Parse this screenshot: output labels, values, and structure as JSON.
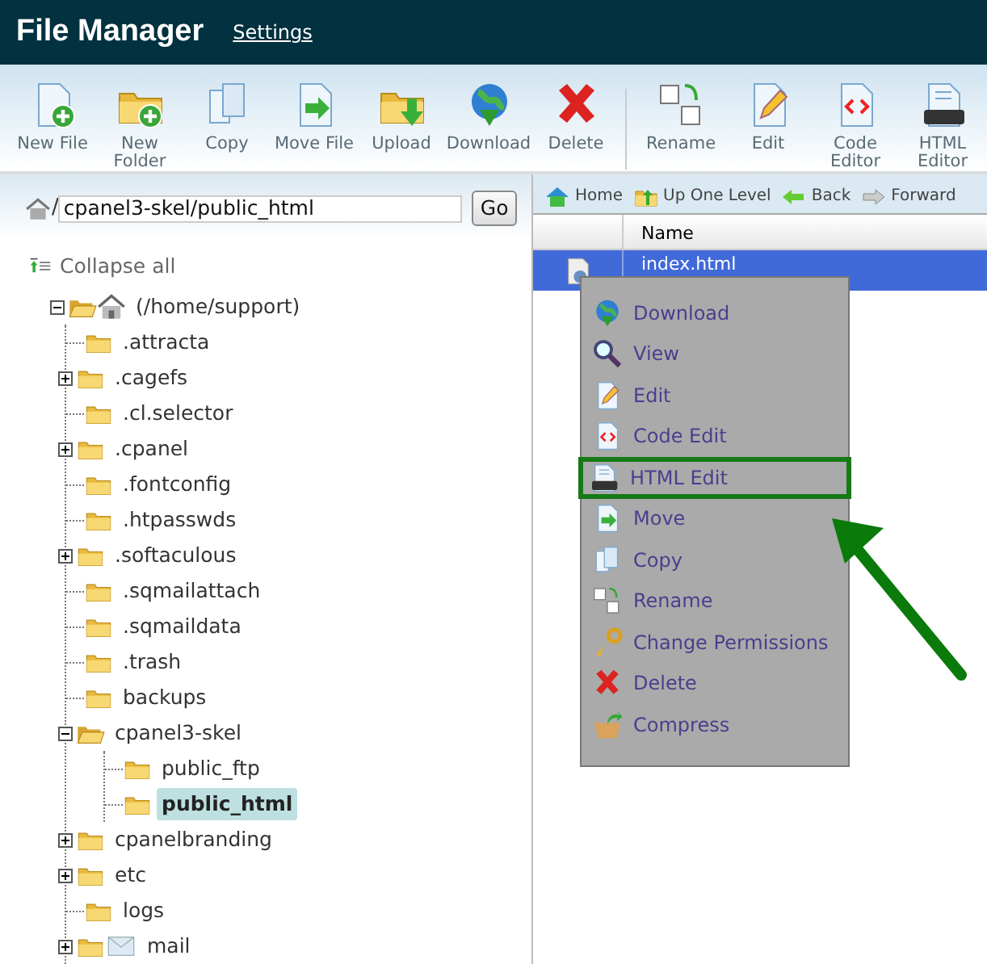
{
  "header": {
    "title": "File Manager",
    "link": "Settings"
  },
  "toolbar_groups": [
    {
      "buttons": [
        "New File",
        "New Folder",
        "Copy",
        "Move File",
        "Upload",
        "Download",
        "Delete"
      ]
    },
    {
      "buttons": [
        "Rename",
        "Edit",
        "Code Editor",
        "HTML Editor"
      ]
    }
  ],
  "path_bar": {
    "separator": "/",
    "value": "cpanel3-skel/public_html",
    "button": "Go"
  },
  "collapse_all": "Collapse all",
  "tree": [
    {
      "label": "(/home/support)",
      "kind": "expanded",
      "home": true,
      "selected": false,
      "children": [
        {
          "label": ".attracta",
          "kind": "leaf",
          "selected": false
        },
        {
          "label": ".cagefs",
          "kind": "collapsed",
          "selected": false
        },
        {
          "label": ".cl.selector",
          "kind": "leaf",
          "selected": false
        },
        {
          "label": ".cpanel",
          "kind": "collapsed",
          "selected": false
        },
        {
          "label": ".fontconfig",
          "kind": "leaf",
          "selected": false
        },
        {
          "label": ".htpasswds",
          "kind": "leaf",
          "selected": false
        },
        {
          "label": ".softaculous",
          "kind": "collapsed",
          "selected": false
        },
        {
          "label": ".sqmailattach",
          "kind": "leaf",
          "selected": false
        },
        {
          "label": ".sqmaildata",
          "kind": "leaf",
          "selected": false
        },
        {
          "label": ".trash",
          "kind": "leaf",
          "selected": false
        },
        {
          "label": "backups",
          "kind": "leaf",
          "selected": false
        },
        {
          "label": "cpanel3-skel",
          "kind": "expanded",
          "selected": false,
          "children": [
            {
              "label": "public_ftp",
              "kind": "leaf",
              "selected": false
            },
            {
              "label": "public_html",
              "kind": "leaf",
              "selected": true
            }
          ]
        },
        {
          "label": "cpanelbranding",
          "kind": "collapsed",
          "selected": false
        },
        {
          "label": "etc",
          "kind": "collapsed",
          "selected": false
        },
        {
          "label": "logs",
          "kind": "leaf",
          "selected": false
        },
        {
          "label": "mail",
          "kind": "collapsed",
          "mail": true,
          "selected": false
        }
      ]
    }
  ],
  "nav": [
    "Home",
    "Up One Level",
    "Back",
    "Forward"
  ],
  "table": {
    "columns": [
      "Name"
    ],
    "rows": [
      {
        "name": "index.html",
        "selected": true
      }
    ]
  },
  "context_menu": [
    {
      "label": "Download",
      "highlighted": false
    },
    {
      "label": "View",
      "highlighted": false
    },
    {
      "label": "Edit",
      "highlighted": false
    },
    {
      "label": "Code Edit",
      "highlighted": false
    },
    {
      "label": "HTML Edit",
      "highlighted": true
    },
    {
      "label": "Move",
      "highlighted": false
    },
    {
      "label": "Copy",
      "highlighted": false
    },
    {
      "label": "Rename",
      "highlighted": false
    },
    {
      "label": "Change Permissions",
      "highlighted": false
    },
    {
      "label": "Delete",
      "highlighted": false
    },
    {
      "label": "Compress",
      "highlighted": false
    }
  ]
}
